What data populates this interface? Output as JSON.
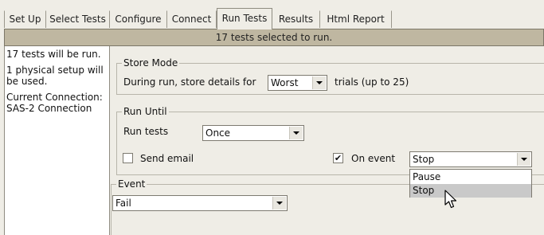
{
  "tabs": [
    {
      "label": "Set Up"
    },
    {
      "label": "Select Tests"
    },
    {
      "label": "Configure"
    },
    {
      "label": "Connect"
    },
    {
      "label": "Run Tests",
      "active": true
    },
    {
      "label": "Results"
    },
    {
      "label": "Html Report"
    }
  ],
  "status": "17 tests selected to run.",
  "info": {
    "line1": "17 tests will be run.",
    "line2": "1 physical setup will be used.",
    "line3": "Current Connection: SAS-2 Connection"
  },
  "store_mode": {
    "legend": "Store Mode",
    "label_before": "During run, store details for",
    "value": "Worst",
    "label_after": "trials (up to 25)"
  },
  "run_until": {
    "legend": "Run Until",
    "run_tests_label": "Run tests",
    "run_tests_value": "Once",
    "send_email_label": "Send email",
    "send_email_checked": false,
    "on_event_label": "On event",
    "on_event_checked": true,
    "on_event_value": "Stop",
    "on_event_options": [
      "Pause",
      "Stop"
    ]
  },
  "event": {
    "legend": "Event",
    "value": "Fail"
  },
  "colors": {
    "background": "#efede6",
    "status_bar": "#bfb7a1",
    "selected_option": "#c9c9c9"
  }
}
